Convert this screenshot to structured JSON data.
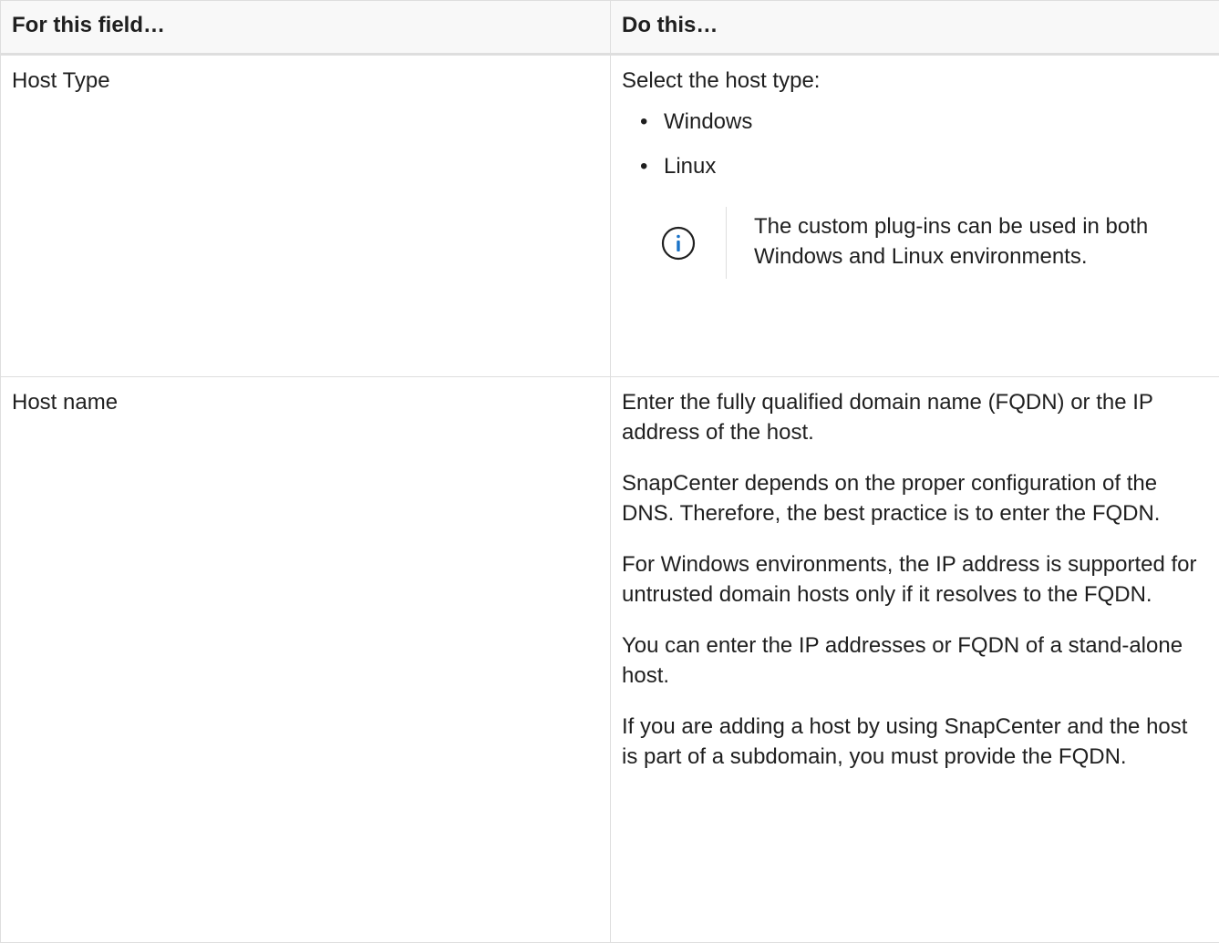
{
  "table": {
    "headers": [
      "For this field…",
      "Do this…"
    ],
    "rows": [
      {
        "field": "Host Type",
        "intro": "Select the host type:",
        "options": [
          "Windows",
          "Linux"
        ],
        "note": {
          "icon": "info-icon",
          "text": "The custom plug-ins can be used in both Windows and Linux environments."
        }
      },
      {
        "field": "Host name",
        "paragraphs": [
          "Enter the fully qualified domain name (FQDN) or the IP address of the host.",
          "SnapCenter depends on the proper configuration of the DNS. Therefore, the best practice is to enter the FQDN.",
          "For Windows environments, the IP address is supported for untrusted domain hosts only if it resolves to the FQDN.",
          "You can enter the IP addresses or FQDN of a stand-alone host.",
          "If you are adding a host by using SnapCenter and the host is part of a subdomain, you must provide the FQDN."
        ]
      }
    ]
  },
  "colors": {
    "border": "#dedede",
    "header_bg": "#f8f8f8",
    "text": "#1f1f1f",
    "info_icon": "#1a73c8"
  }
}
